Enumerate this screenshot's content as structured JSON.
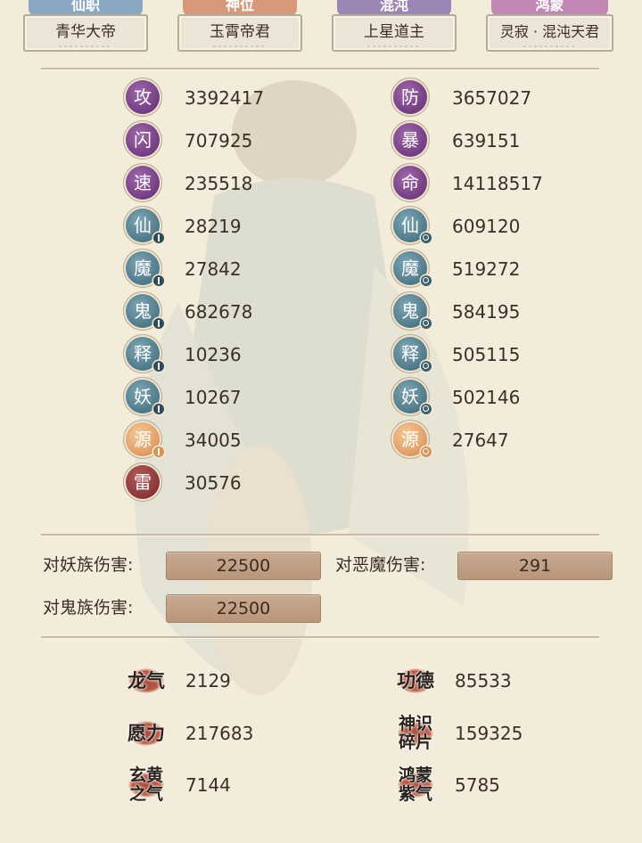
{
  "tabs": [
    {
      "cap": "仙职",
      "value": "青华大帝",
      "capColor": "#8aa7c4"
    },
    {
      "cap": "神位",
      "value": "玉霄帝君",
      "capColor": "#d9987a"
    },
    {
      "cap": "混沌",
      "value": "上星道主",
      "capColor": "#9b86b5"
    },
    {
      "cap": "鸿蒙",
      "value": "灵寂 · 混沌天君",
      "capColor": "#c187b5"
    }
  ],
  "stats": {
    "left": [
      {
        "icon": "攻",
        "value": "3392417"
      },
      {
        "icon": "闪",
        "value": "707925"
      },
      {
        "icon": "速",
        "value": "235518"
      },
      {
        "icon": "仙",
        "value": "28219"
      },
      {
        "icon": "魔",
        "value": "27842"
      },
      {
        "icon": "鬼",
        "value": "682678"
      },
      {
        "icon": "释",
        "value": "10236"
      },
      {
        "icon": "妖",
        "value": "10267"
      },
      {
        "icon": "源",
        "value": "34005"
      },
      {
        "icon": "雷",
        "value": "30576"
      }
    ],
    "right": [
      {
        "icon": "防",
        "value": "3657027"
      },
      {
        "icon": "暴",
        "value": "639151"
      },
      {
        "icon": "命",
        "value": "14118517"
      },
      {
        "icon": "仙",
        "value": "609120"
      },
      {
        "icon": "魔",
        "value": "519272"
      },
      {
        "icon": "鬼",
        "value": "584195"
      },
      {
        "icon": "释",
        "value": "505115"
      },
      {
        "icon": "妖",
        "value": "502146"
      },
      {
        "icon": "源",
        "value": "27647"
      }
    ]
  },
  "damage": {
    "vs_yao_label": "对妖族伤害:",
    "vs_yao_value": "22500",
    "vs_emo_label": "对恶魔伤害:",
    "vs_emo_value": "291",
    "vs_gui_label": "对鬼族伤害:",
    "vs_gui_value": "22500"
  },
  "resources": {
    "longqi_icon": "龙气",
    "longqi": "2129",
    "gongde_icon": "功德",
    "gongde": "85533",
    "yuanli_icon": "愿力",
    "yuanli": "217683",
    "shenshi_icon_1": "神识",
    "shenshi_icon_2": "碎片",
    "shenshi": "159325",
    "xuanhuang_icon_1": "玄黄",
    "xuanhuang_icon_2": "之气",
    "xuanhuang": "7144",
    "hongmeng_icon_1": "鸿蒙",
    "hongmeng_icon_2": "紫气",
    "hongmeng": "5785"
  }
}
